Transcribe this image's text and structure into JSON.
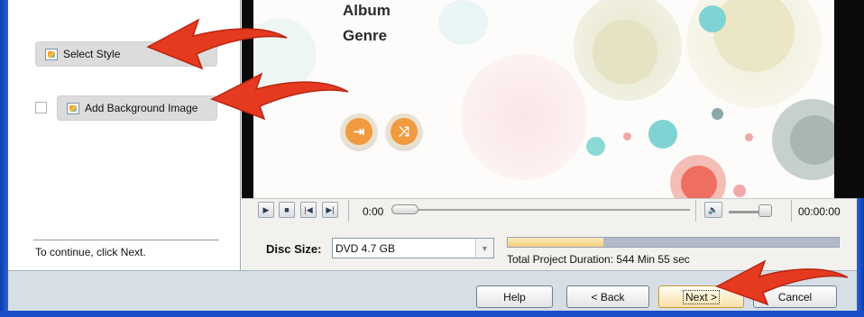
{
  "left_panel": {
    "select_style_label": "Select Style",
    "add_background_label": "Add Background Image",
    "add_background_checked": false,
    "continue_text": "To continue, click Next."
  },
  "preview": {
    "menu_items": [
      "Album",
      "Genre"
    ],
    "play_all_icon": "play-all-icon",
    "shuffle_icon": "shuffle-icon"
  },
  "player": {
    "current_time": "0:00",
    "total_time": "00:00:00",
    "volume_level": 0.85
  },
  "disc": {
    "label": "Disc Size:",
    "selected": "DVD 4.7 GB",
    "usage_fraction": 0.29,
    "duration_text": "Total Project Duration: 544 Min 55 sec"
  },
  "buttons": {
    "help": "Help",
    "back": "< Back",
    "next": "Next >",
    "cancel": "Cancel"
  },
  "colors": {
    "accent_orange": "#f29a3f",
    "annotation_red": "#e53a1f",
    "window_frame": "#1a4fc9"
  }
}
